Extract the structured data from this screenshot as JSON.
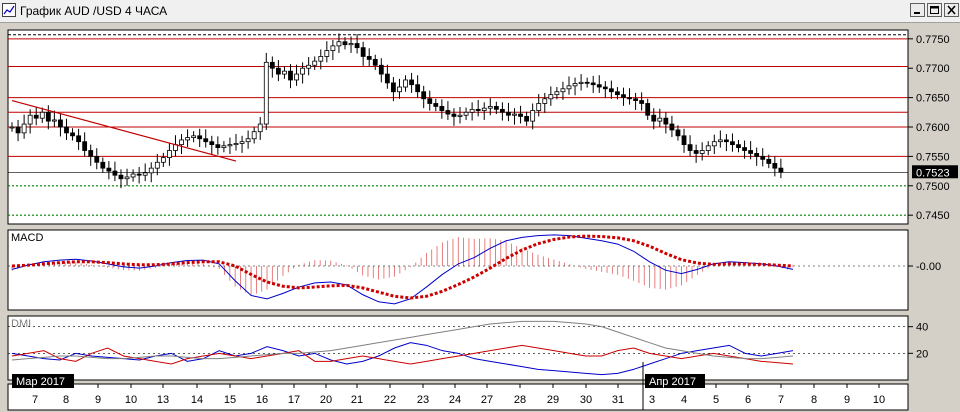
{
  "window": {
    "title": "График AUD /USD  4 ЧАСА"
  },
  "colors": {
    "background": "#ffffff",
    "candle": "#000000",
    "resistance": "#c00000",
    "support": "#008000",
    "trendline": "#c00000",
    "macd_line": "#0000cc",
    "macd_signal": "#cc0000",
    "dmi_plus": "#0000cc",
    "dmi_minus": "#cc0000",
    "adx": "#808080"
  },
  "chart_data": [
    {
      "type": "candlestick",
      "title": "График AUD /USD  4 ЧАСА",
      "ylim": [
        0.7435,
        0.7765
      ],
      "y_ticks": [
        "0.7750",
        "0.7700",
        "0.7650",
        "0.7600",
        "0.7550",
        "0.7500",
        "0.7450"
      ],
      "current_price": "0.7523",
      "x_tick_labels": [
        "7",
        "8",
        "9",
        "10",
        "13",
        "14",
        "15",
        "16",
        "17",
        "20",
        "21",
        "22",
        "23",
        "24",
        "27",
        "28",
        "29",
        "30",
        "31",
        "3",
        "4",
        "5",
        "6",
        "7",
        "8",
        "9",
        "10"
      ],
      "month_labels": [
        "Мар 2017",
        "Апр 2017"
      ],
      "resistance_levels": [
        0.775,
        0.7703,
        0.765,
        0.7625,
        0.76,
        0.755
      ],
      "support_levels": [
        0.75,
        0.745
      ],
      "trendline": {
        "from": [
          0,
          0.7645
        ],
        "to": [
          37,
          0.7542
        ]
      },
      "close_series": [
        0.76,
        0.759,
        0.7605,
        0.762,
        0.7615,
        0.7625,
        0.761,
        0.7612,
        0.76,
        0.759,
        0.7585,
        0.7575,
        0.756,
        0.755,
        0.754,
        0.753,
        0.7525,
        0.7518,
        0.7512,
        0.7515,
        0.752,
        0.7518,
        0.7522,
        0.753,
        0.754,
        0.7548,
        0.756,
        0.757,
        0.7578,
        0.7582,
        0.7585,
        0.758,
        0.7575,
        0.757,
        0.7565,
        0.7568,
        0.757,
        0.7572,
        0.7575,
        0.758,
        0.7592,
        0.7605,
        0.771,
        0.77,
        0.769,
        0.7695,
        0.768,
        0.769,
        0.77,
        0.7705,
        0.7712,
        0.772,
        0.773,
        0.7738,
        0.7745,
        0.774,
        0.7742,
        0.7735,
        0.772,
        0.7715,
        0.7705,
        0.769,
        0.7675,
        0.766,
        0.7668,
        0.768,
        0.7672,
        0.766,
        0.7648,
        0.764,
        0.7635,
        0.7628,
        0.7622,
        0.7618,
        0.762,
        0.7625,
        0.763,
        0.7628,
        0.7632,
        0.7635,
        0.763,
        0.7625,
        0.762,
        0.7622,
        0.7618,
        0.761,
        0.7628,
        0.764,
        0.7648,
        0.7655,
        0.766,
        0.7665,
        0.767,
        0.7674,
        0.7676,
        0.7675,
        0.7672,
        0.7668,
        0.7665,
        0.766,
        0.7655,
        0.765,
        0.7648,
        0.7645,
        0.764,
        0.762,
        0.761,
        0.7615,
        0.7605,
        0.7595,
        0.7585,
        0.757,
        0.756,
        0.7555,
        0.756,
        0.7568,
        0.7575,
        0.7578,
        0.7575,
        0.757,
        0.7565,
        0.756,
        0.7555,
        0.755,
        0.7545,
        0.7538,
        0.753,
        0.7523
      ],
      "bar_count": 130
    },
    {
      "type": "line",
      "title": "MACD",
      "y_ticks": [
        "-0.00"
      ],
      "series": [
        {
          "role": "macd",
          "values": [
            -0.08,
            0.02,
            0.1,
            0.14,
            0.16,
            0.12,
            0.05,
            -0.02,
            -0.05,
            0.0,
            0.08,
            0.13,
            0.14,
            0.05,
            -0.35,
            -0.7,
            -0.78,
            -0.65,
            -0.5,
            -0.4,
            -0.38,
            -0.45,
            -0.68,
            -0.85,
            -0.9,
            -0.78,
            -0.5,
            -0.2,
            0.05,
            0.2,
            0.42,
            0.6,
            0.68,
            0.72,
            0.74,
            0.72,
            0.66,
            0.6,
            0.52,
            0.35,
            0.1,
            -0.1,
            -0.18,
            -0.08,
            0.05,
            0.1,
            0.08,
            0.05,
            0.0,
            -0.08
          ]
        },
        {
          "role": "signal",
          "values": [
            0.0,
            0.02,
            0.05,
            0.08,
            0.1,
            0.1,
            0.08,
            0.05,
            0.03,
            0.03,
            0.05,
            0.08,
            0.1,
            0.1,
            0.0,
            -0.2,
            -0.38,
            -0.48,
            -0.52,
            -0.5,
            -0.47,
            -0.46,
            -0.52,
            -0.62,
            -0.72,
            -0.76,
            -0.72,
            -0.6,
            -0.44,
            -0.26,
            -0.05,
            0.18,
            0.38,
            0.53,
            0.63,
            0.69,
            0.71,
            0.7,
            0.67,
            0.6,
            0.47,
            0.3,
            0.15,
            0.07,
            0.04,
            0.05,
            0.05,
            0.04,
            0.02,
            0.0
          ]
        }
      ]
    },
    {
      "type": "line",
      "title": "DMI",
      "y_ticks": [
        "40",
        "20"
      ],
      "ylim": [
        0,
        48
      ],
      "series": [
        {
          "role": "plus",
          "values": [
            20,
            18,
            16,
            15,
            20,
            18,
            17,
            16,
            15,
            18,
            20,
            14,
            16,
            22,
            18,
            20,
            25,
            22,
            18,
            20,
            15,
            12,
            14,
            18,
            24,
            28,
            26,
            22,
            20,
            16,
            14,
            12,
            10,
            8,
            7,
            6,
            5,
            4,
            5,
            8,
            12,
            16,
            20,
            22,
            24,
            26,
            20,
            18,
            20,
            22
          ]
        },
        {
          "role": "minus",
          "values": [
            18,
            20,
            22,
            16,
            14,
            20,
            24,
            18,
            16,
            14,
            12,
            16,
            18,
            20,
            18,
            16,
            18,
            20,
            22,
            14,
            14,
            16,
            18,
            16,
            14,
            12,
            14,
            16,
            18,
            20,
            22,
            24,
            26,
            24,
            22,
            20,
            18,
            18,
            22,
            24,
            20,
            18,
            16,
            18,
            20,
            18,
            16,
            14,
            13,
            12
          ]
        },
        {
          "role": "adx",
          "values": [
            15,
            16,
            17,
            18,
            18,
            17,
            16,
            16,
            17,
            18,
            18,
            17,
            16,
            16,
            17,
            18,
            19,
            20,
            20,
            21,
            22,
            24,
            26,
            28,
            30,
            32,
            34,
            36,
            38,
            40,
            42,
            43,
            44,
            44,
            44,
            43,
            42,
            40,
            36,
            32,
            28,
            24,
            22,
            20,
            18,
            17,
            16,
            16,
            17,
            18
          ]
        }
      ]
    }
  ]
}
